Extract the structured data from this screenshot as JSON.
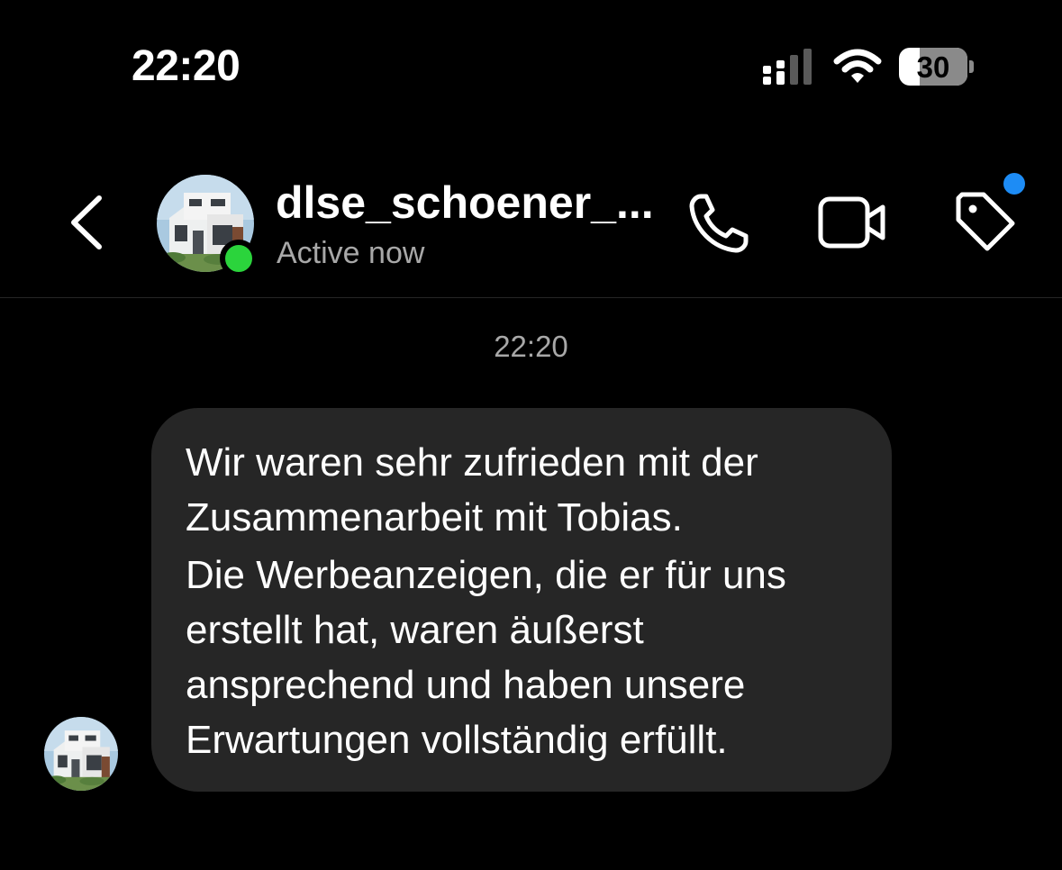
{
  "status_bar": {
    "time": "22:20",
    "battery_level": "30",
    "battery_fraction": 0.3,
    "icons": [
      "cellular-signal-icon",
      "wifi-icon",
      "battery-icon"
    ]
  },
  "header": {
    "username": "dlse_schoener_...",
    "status": "Active now",
    "online_indicator_color": "#2bd43c",
    "notification_dot_color": "#1d8cf5",
    "icons": [
      "back-chevron-icon",
      "phone-icon",
      "video-camera-icon",
      "tag-icon"
    ]
  },
  "chat": {
    "timestamp": "22:20",
    "message": {
      "paragraphs": [
        "Wir waren sehr zufrieden mit der Zusammenarbeit mit Tobias.",
        "Die Werbeanzeigen, die er für uns erstellt hat, waren äußerst ansprechend und haben unsere Erwartungen vollständig erfüllt."
      ],
      "bubble_color": "#262626"
    }
  }
}
